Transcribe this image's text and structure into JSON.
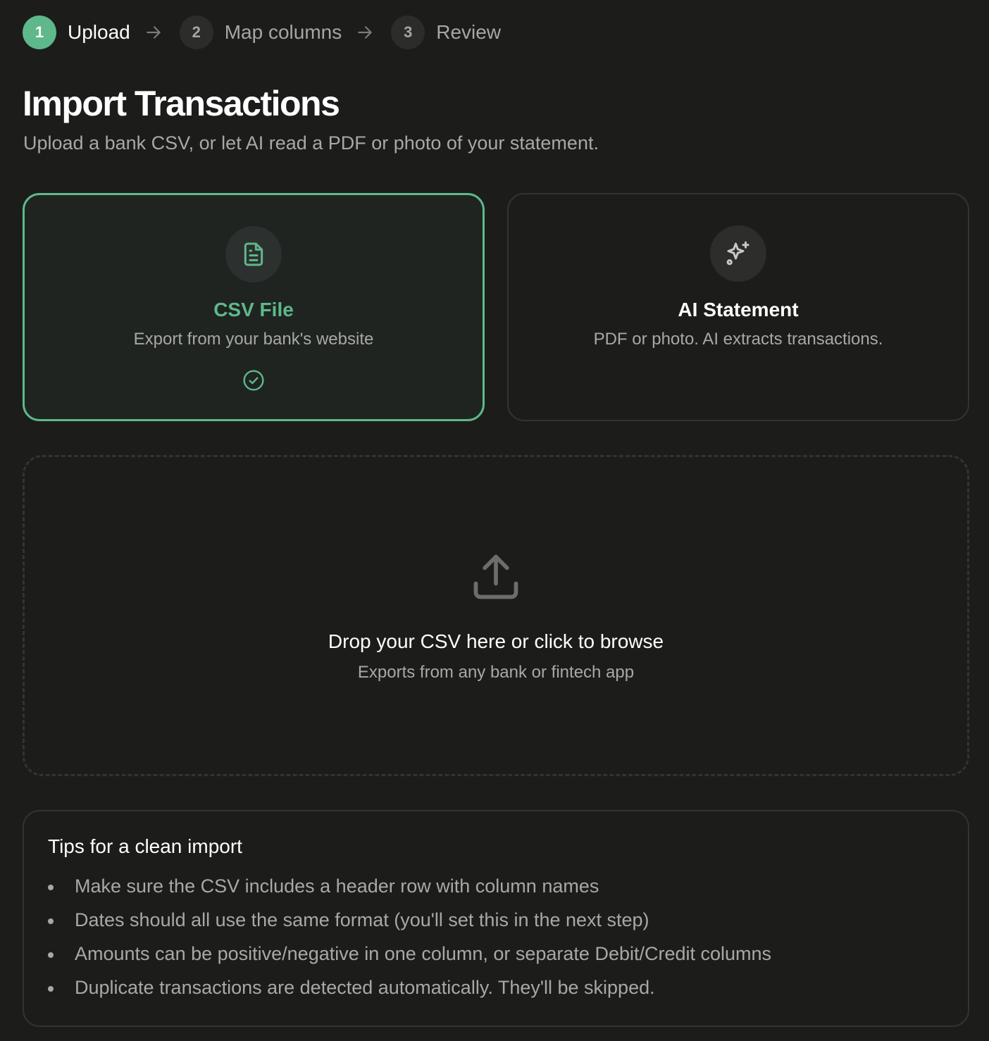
{
  "stepper": {
    "steps": [
      {
        "number": "1",
        "label": "Upload",
        "active": true
      },
      {
        "number": "2",
        "label": "Map columns",
        "active": false
      },
      {
        "number": "3",
        "label": "Review",
        "active": false
      }
    ]
  },
  "header": {
    "title": "Import Transactions",
    "subtitle": "Upload a bank CSV, or let AI read a PDF or photo of your statement."
  },
  "options": {
    "csv": {
      "title": "CSV File",
      "description": "Export from your bank's website",
      "icon": "file-text-icon",
      "selected": true
    },
    "ai": {
      "title": "AI Statement",
      "description": "PDF or photo. AI extracts transactions.",
      "icon": "sparkles-icon",
      "selected": false
    }
  },
  "dropzone": {
    "title": "Drop your CSV here or click to browse",
    "subtitle": "Exports from any bank or fintech app",
    "icon": "upload-icon"
  },
  "tips": {
    "title": "Tips for a clean import",
    "items": [
      "Make sure the CSV includes a header row with column names",
      "Dates should all use the same format (you'll set this in the next step)",
      "Amounts can be positive/negative in one column, or separate Debit/Credit columns",
      "Duplicate transactions are detected automatically. They'll be skipped."
    ]
  },
  "colors": {
    "background": "#1c1c1b",
    "accent": "#5eb88b",
    "border": "#333331",
    "muted_text": "#a8a8a4"
  }
}
